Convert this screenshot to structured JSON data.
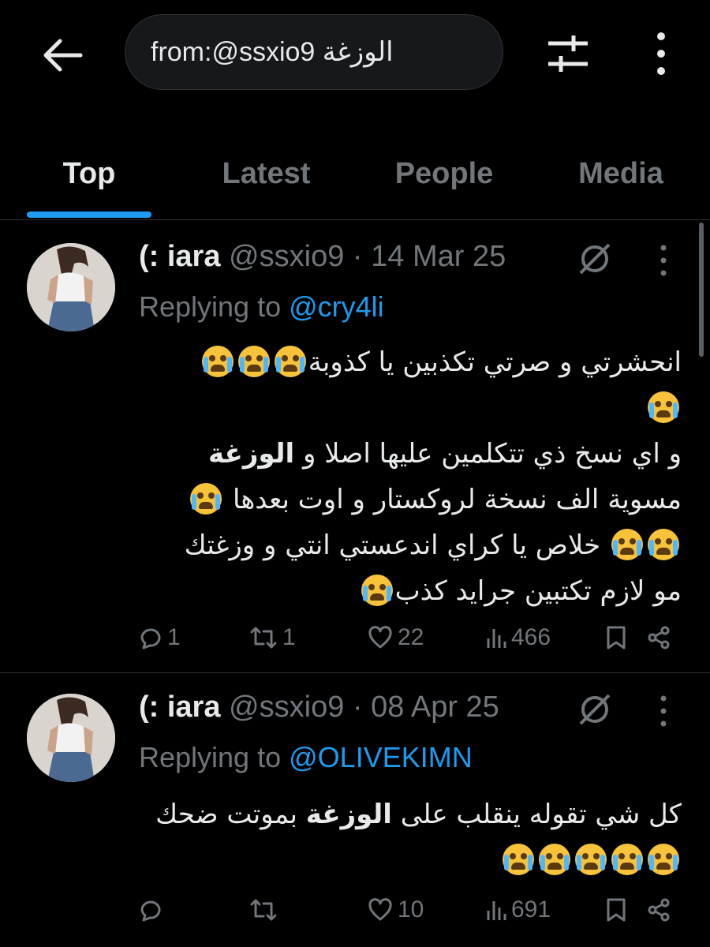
{
  "search": {
    "query": "from:@ssxio9 الوزغة"
  },
  "tabs": [
    {
      "label": "Top",
      "active": true
    },
    {
      "label": "Latest",
      "active": false
    },
    {
      "label": "People",
      "active": false
    },
    {
      "label": "Media",
      "active": false
    }
  ],
  "colors": {
    "accent": "#1d9bf0",
    "background": "#000000",
    "secondary_text": "#71767b"
  },
  "tweets": [
    {
      "name": "(: iara",
      "handle": "@ssxio9",
      "sep": "·",
      "date": "14 Mar 25",
      "replying_prefix": "Replying to",
      "replying_to": "@cry4li",
      "lines": [
        "انحشرتي و صرتي تكذبين يا كذوبة",
        "",
        "و اي نسخ ذي تتكلمين عليها اصلا و",
        "مسوية الف نسخة لروكستار و اوت بعدها",
        "خلاص يا كراي اندعستي انتي و وزغتك",
        "مو لازم تكتبين جرايد كذب"
      ],
      "highlight": "الوزغة",
      "replies": "1",
      "reposts": "1",
      "likes": "22",
      "views": "466"
    },
    {
      "name": "(: iara",
      "handle": "@ssxio9",
      "sep": "·",
      "date": "08 Apr 25",
      "replying_prefix": "Replying to",
      "replying_to": "@OLIVEKIMN",
      "lines": [
        "كل شي تقوله ينقلب على",
        "بموتت ضحك",
        ""
      ],
      "highlight": "الوزغة",
      "replies": "",
      "reposts": "",
      "likes": "10",
      "views": "691"
    }
  ],
  "icons": {
    "back": "arrow-left-icon",
    "filter": "sliders-icon",
    "more": "more-vertical-icon",
    "grok": "grok-icon",
    "reply": "reply-icon",
    "repost": "repost-icon",
    "like": "heart-icon",
    "views": "views-icon",
    "bookmark": "bookmark-icon",
    "share": "share-icon"
  }
}
